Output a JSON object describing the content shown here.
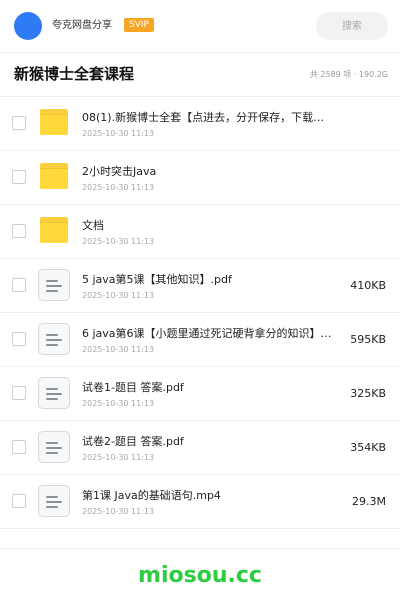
{
  "header": {
    "sharer_name": "夸克网盘分享",
    "badge": "SVIP",
    "search_placeholder": "搜索"
  },
  "share": {
    "title": "新猴博士全套课程",
    "stats": "共 2589 项 · 190.2G"
  },
  "files": [
    {
      "type": "folder",
      "name": "08(1).新猴博士全套【点进去，分开保存，下载后…",
      "date": "2025-10-30 11:13",
      "size": ""
    },
    {
      "type": "folder",
      "name": "2小时突击Java",
      "date": "2025-10-30 11:13",
      "size": ""
    },
    {
      "type": "folder",
      "name": "文档",
      "date": "2025-10-30 11:13",
      "size": ""
    },
    {
      "type": "file",
      "name": "5 java第5课【其他知识】.pdf",
      "date": "2025-10-30 11:13",
      "size": "410KB"
    },
    {
      "type": "file",
      "name": "6 java第6课【小题里通过死记硬背拿分的知识】…",
      "date": "2025-10-30 11:13",
      "size": "595KB"
    },
    {
      "type": "file",
      "name": "试卷1-题目 答案.pdf",
      "date": "2025-10-30 11:13",
      "size": "325KB"
    },
    {
      "type": "file",
      "name": "试卷2-题目 答案.pdf",
      "date": "2025-10-30 11:13",
      "size": "354KB"
    },
    {
      "type": "file",
      "name": "第1课 Java的基础语句.mp4",
      "date": "2025-10-30 11:13",
      "size": "29.3M"
    }
  ],
  "watermark": "miosou.cc",
  "colors": {
    "avatar": "#2f7bf6",
    "svip_badge": "#f5a623",
    "folder": "#ffd83a",
    "watermark": "#2ecc40"
  },
  "icons": {
    "folder": "folder-icon",
    "file": "document-icon"
  }
}
